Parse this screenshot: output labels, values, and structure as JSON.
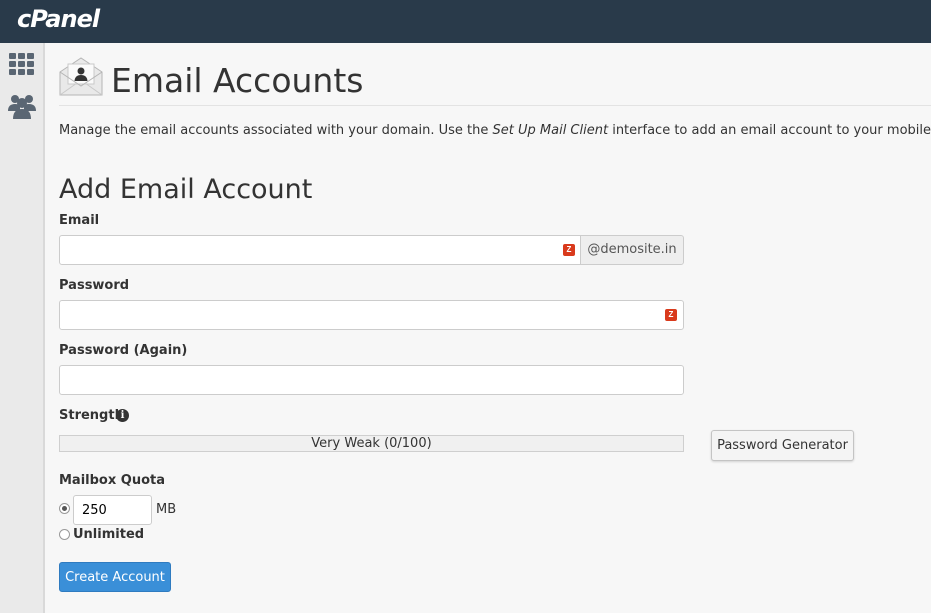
{
  "header": {
    "logo": "cPanel"
  },
  "sidebar": {
    "items": [
      {
        "icon": "grid-icon",
        "name": "sidebar-item-home"
      },
      {
        "icon": "users-icon",
        "name": "sidebar-item-user-manager"
      }
    ]
  },
  "page": {
    "title": "Email Accounts",
    "description_before": "Manage the email accounts associated with your domain. Use the ",
    "description_link": "Set Up Mail Client",
    "description_after": " interface to add an email account to your mobile device or deskto"
  },
  "form": {
    "section_title": "Add Email Account",
    "email_label": "Email",
    "email_value": "",
    "email_domain": "@demosite.in",
    "password_label": "Password",
    "password_value": "",
    "password_again_label": "Password (Again)",
    "password_again_value": "",
    "strength_label": "Strength",
    "strength_text": "Very Weak (0/100)",
    "strength_value": 0,
    "password_generator_label": "Password Generator",
    "quota_label": "Mailbox Quota",
    "quota_value": "250",
    "quota_unit": "MB",
    "unlimited_label": "Unlimited",
    "create_button_label": "Create Account"
  },
  "colors": {
    "topbar": "#293a4a",
    "primary_button": "#3a8fd8",
    "field_icon": "#d93a1c"
  }
}
